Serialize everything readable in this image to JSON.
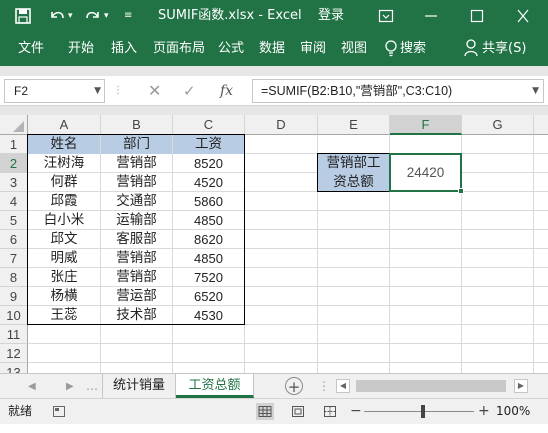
{
  "titlebar": {
    "title": "SUMIF函数.xlsx  -  Excel",
    "login": "登录"
  },
  "ribbon": {
    "tabs": [
      "文件",
      "开始",
      "插入",
      "页面布局",
      "公式",
      "数据",
      "审阅",
      "视图"
    ],
    "search": "搜索",
    "share": "共享(S)"
  },
  "formula_bar": {
    "name_box": "F2",
    "formula": "=SUMIF(B2:B10,\"营销部\",C3:C10)"
  },
  "grid": {
    "columns": [
      "A",
      "B",
      "C",
      "D",
      "E",
      "F",
      "G"
    ],
    "selected_column": "F",
    "rows": [
      "1",
      "2",
      "3",
      "4",
      "5",
      "6",
      "7",
      "8",
      "9",
      "10",
      "11",
      "12",
      "13"
    ],
    "table_headers": [
      "姓名",
      "部门",
      "工资"
    ],
    "table_rows": [
      [
        "汪树海",
        "营销部",
        "8520"
      ],
      [
        "何群",
        "营销部",
        "4520"
      ],
      [
        "邱霞",
        "交通部",
        "5860"
      ],
      [
        "白小米",
        "运输部",
        "4850"
      ],
      [
        "邱文",
        "客服部",
        "8620"
      ],
      [
        "明威",
        "营销部",
        "4850"
      ],
      [
        "张庄",
        "营销部",
        "7520"
      ],
      [
        "杨横",
        "营运部",
        "6520"
      ],
      [
        "王蕊",
        "技术部",
        "4530"
      ]
    ],
    "summary_label_line1": "营销部工",
    "summary_label_line2": "资总额",
    "summary_value": "24420"
  },
  "sheets": {
    "tabs": [
      "统计销量",
      "工资总额"
    ],
    "active": "工资总额"
  },
  "status": {
    "mode": "就绪",
    "zoom": "100%"
  },
  "colors": {
    "ribbon_green": "#217346",
    "table_header_fill": "#b8cce4"
  }
}
